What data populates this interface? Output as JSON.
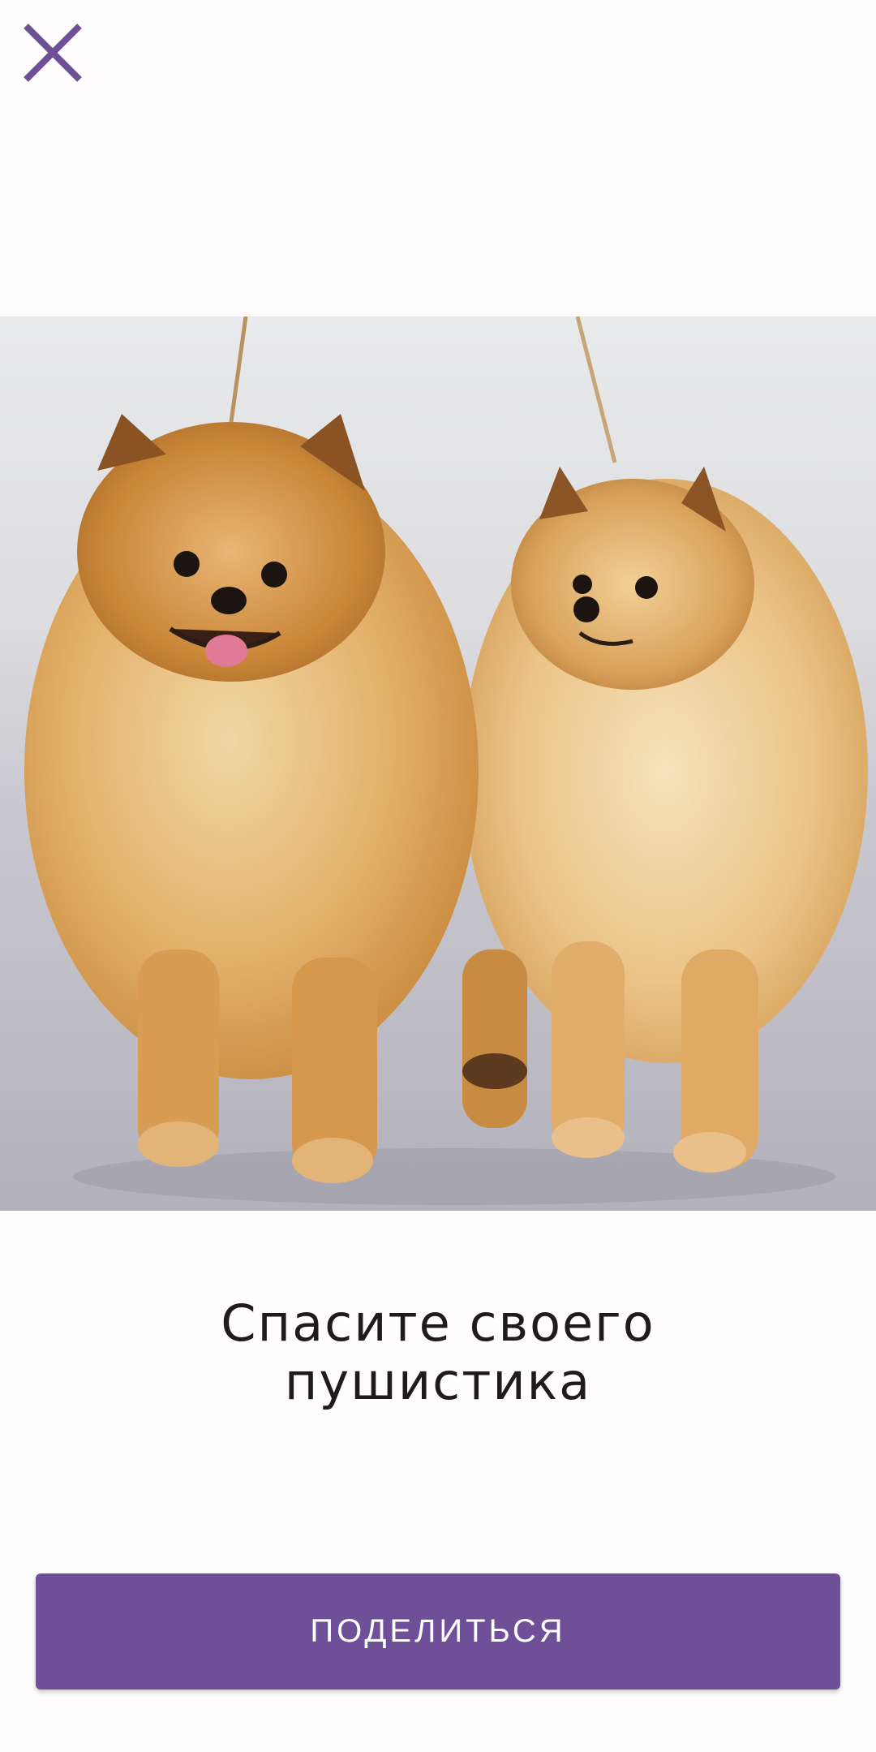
{
  "header": {
    "close_icon": "close-icon"
  },
  "media": {
    "image": "two-pomeranian-dogs-photo"
  },
  "content": {
    "caption_line_1": "Спасите своего",
    "caption_line_2": "пушистика"
  },
  "actions": {
    "share_label": "ПОДЕЛИТЬСЯ"
  },
  "colors": {
    "accent": "#6f4f98",
    "background": "#fefcfd",
    "text": "#1e1b1f"
  }
}
